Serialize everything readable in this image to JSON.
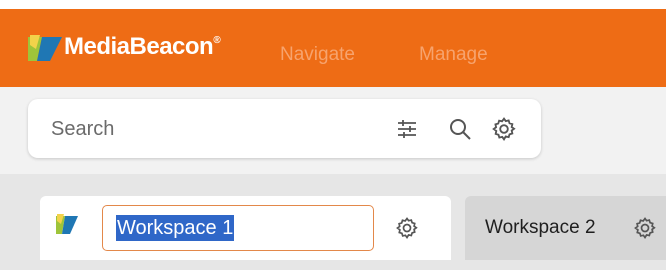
{
  "header": {
    "brand": "MediaBeacon",
    "brand_mark": "®",
    "nav": [
      {
        "label": "Navigate"
      },
      {
        "label": "Manage"
      }
    ],
    "colors": {
      "bar": "#ee6c15",
      "nav_text": "#f7a36d"
    }
  },
  "search": {
    "placeholder": "Search",
    "value": "",
    "icons": [
      "filter-sliders-icon",
      "search-icon",
      "gear-icon"
    ]
  },
  "workspaces": {
    "tabs": [
      {
        "label": "Workspace 1",
        "editing": true,
        "selected_text": true,
        "icon": "gear-icon"
      },
      {
        "label": "Workspace 2",
        "editing": false,
        "icon": "gear-icon"
      }
    ],
    "colors": {
      "selection": "#2f67c8",
      "input_border": "#e3884a"
    }
  }
}
